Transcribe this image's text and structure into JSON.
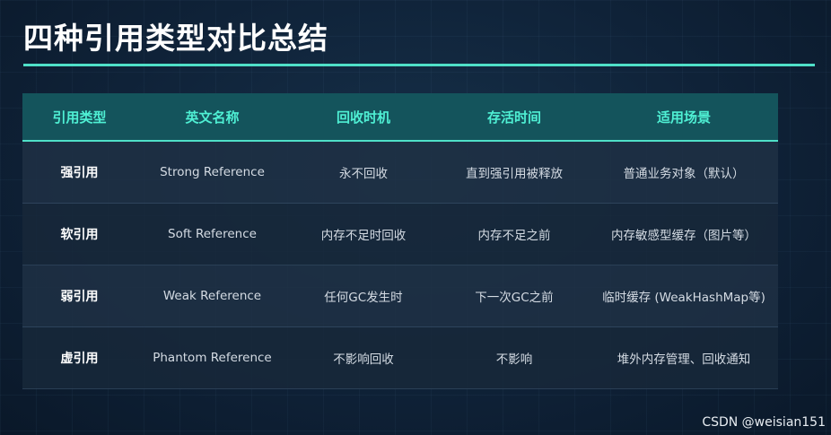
{
  "title": "四种引用类型对比总结",
  "table": {
    "headers": [
      "引用类型",
      "英文名称",
      "回收时机",
      "存活时间",
      "适用场景"
    ],
    "rows": [
      {
        "type": "强引用",
        "english": "Strong Reference",
        "recycle": "永不回收",
        "lifetime": "直到强引用被释放",
        "usage": "普通业务对象（默认）"
      },
      {
        "type": "软引用",
        "english": "Soft Reference",
        "recycle": "内存不足时回收",
        "lifetime": "内存不足之前",
        "usage": "内存敏感型缓存（图片等）"
      },
      {
        "type": "弱引用",
        "english": "Weak Reference",
        "recycle": "任何GC发生时",
        "lifetime": "下一次GC之前",
        "usage": "临时缓存 (WeakHashMap等)"
      },
      {
        "type": "虚引用",
        "english": "Phantom Reference",
        "recycle": "不影响回收",
        "lifetime": "不影响",
        "usage": "堆外内存管理、回收通知"
      }
    ]
  },
  "watermark": "CSDN @weisian151",
  "colors": {
    "accent": "#4fe0c8",
    "header_bg": "#14545c",
    "background": "#0f2238"
  }
}
